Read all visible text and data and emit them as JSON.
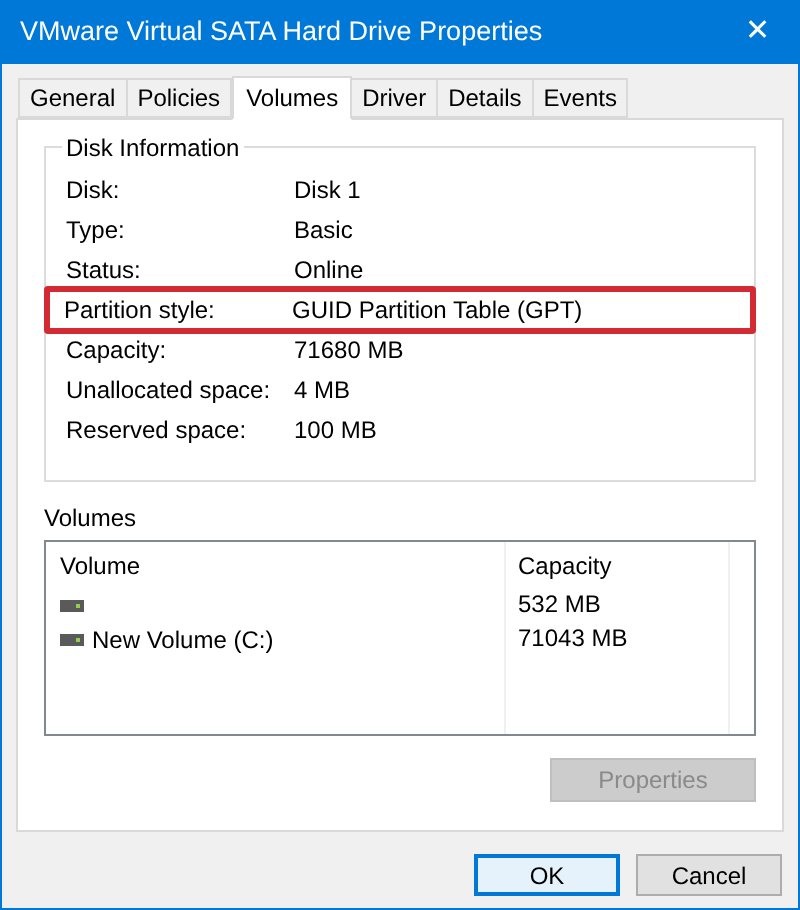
{
  "window": {
    "title": "VMware Virtual SATA Hard Drive Properties",
    "close": "✕"
  },
  "tabs": [
    {
      "label": "General",
      "selected": false
    },
    {
      "label": "Policies",
      "selected": false
    },
    {
      "label": "Volumes",
      "selected": true
    },
    {
      "label": "Driver",
      "selected": false
    },
    {
      "label": "Details",
      "selected": false
    },
    {
      "label": "Events",
      "selected": false
    }
  ],
  "disk_information": {
    "title": "Disk Information",
    "rows": [
      {
        "label": "Disk:",
        "value": "Disk 1",
        "highlighted": false
      },
      {
        "label": "Type:",
        "value": "Basic",
        "highlighted": false
      },
      {
        "label": "Status:",
        "value": "Online",
        "highlighted": false
      },
      {
        "label": "Partition style:",
        "value": "GUID Partition Table (GPT)",
        "highlighted": true
      },
      {
        "label": "Capacity:",
        "value": "71680 MB",
        "highlighted": false
      },
      {
        "label": "Unallocated space:",
        "value": "4 MB",
        "highlighted": false
      },
      {
        "label": "Reserved space:",
        "value": "100 MB",
        "highlighted": false
      }
    ]
  },
  "volumes": {
    "title": "Volumes",
    "columns": [
      "Volume",
      "Capacity"
    ],
    "rows": [
      {
        "capacity": "532 MB"
      },
      {
        "name": "New Volume (C:)",
        "capacity": "71043 MB"
      }
    ],
    "properties_button": {
      "label": "Properties",
      "disabled": true
    }
  },
  "buttons": [
    {
      "label": "OK",
      "default": true
    },
    {
      "label": "Cancel",
      "default": false
    }
  ]
}
